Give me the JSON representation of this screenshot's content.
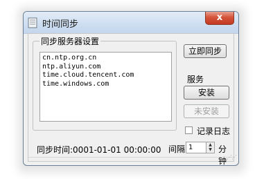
{
  "window": {
    "title": "时间同步",
    "close_label": "x"
  },
  "server_group": {
    "label": "同步服务器设置",
    "servers": [
      "cn.ntp.org.cn",
      "ntp.aliyun.com",
      "time.cloud.tencent.com",
      "time.windows.com"
    ]
  },
  "buttons": {
    "sync_now": "立即同步",
    "install": "安装",
    "uninstall": "未安装"
  },
  "service": {
    "label": "服务"
  },
  "log": {
    "label": "记录日志",
    "checked": false
  },
  "status": {
    "sync_time": "同步时间:0001-01-01 00:00:00",
    "interval_label": "间隔",
    "interval_value": "1",
    "interval_unit": "分钟"
  },
  "colors": {
    "titlebar": "#cfdff1",
    "close_button": "#c94a31",
    "window_bg": "#f0f0f0"
  }
}
